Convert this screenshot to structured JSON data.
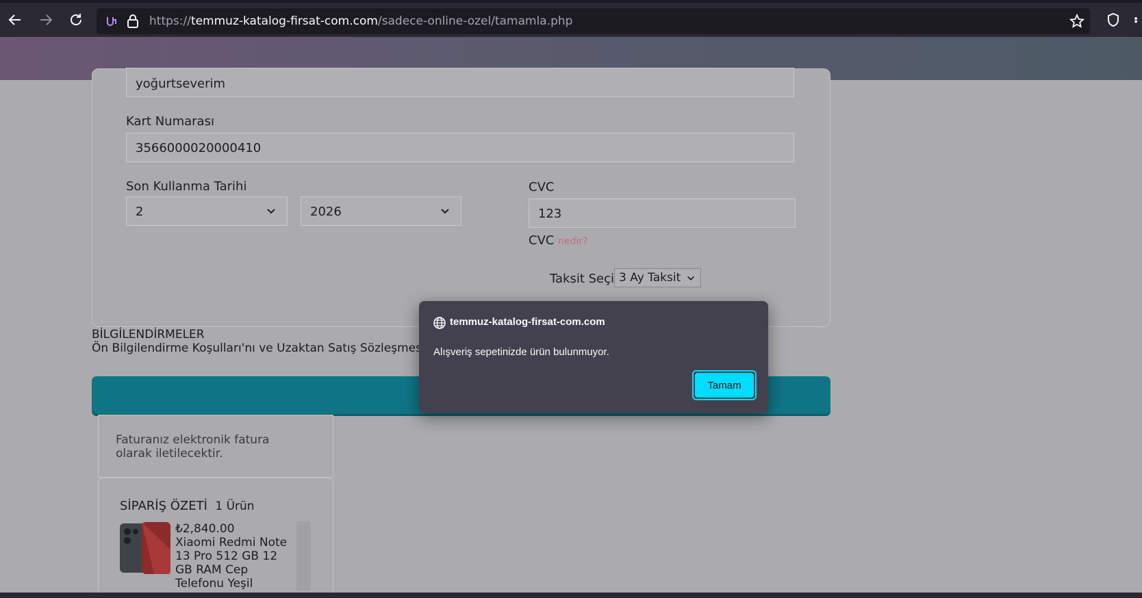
{
  "browser": {
    "url_prefix": "https://",
    "url_domain": "temmuz-katalog-firsat-com.com",
    "url_path": "/sadece-online-ozel/tamamla.php"
  },
  "form": {
    "name_value": "yoğurtseverim",
    "card_number_label": "Kart Numarası",
    "card_number_value": "3566000020000410",
    "expiry_label": "Son Kullanma Tarihi",
    "expiry_month": "2",
    "expiry_year": "2026",
    "cvc_label": "CVC",
    "cvc_value": "123",
    "cvc_help_prefix": "CVC",
    "cvc_help_link": "nedir?",
    "installment_label": "Taksit Seçin",
    "installment_value": "3 Ay Taksit"
  },
  "info": {
    "title": "BİLGİLENDİRMELER",
    "text": "Ön Bilgilendirme Koşulları'nı ve Uzaktan Satış Sözleşmesi'ni okud"
  },
  "invoice_note": "Faturanız elektronik fatura olarak iletilecektir.",
  "order_summary": {
    "title": "SİPARİŞ ÖZETİ",
    "count": "1 Ürün",
    "item_price": "₺2,840.00",
    "item_name": "Xiaomi Redmi Note 13 Pro 512 GB 12 GB RAM Cep Telefonu Yeşil"
  },
  "dialog": {
    "origin": "temmuz-katalog-firsat-com.com",
    "message": "Alışveriş sepetinizde ürün bulunmuyor.",
    "ok_label": "Tamam"
  },
  "colors": {
    "accent": "#00ddff",
    "submit_bar": "#0f7585",
    "link": "#c56b85"
  }
}
